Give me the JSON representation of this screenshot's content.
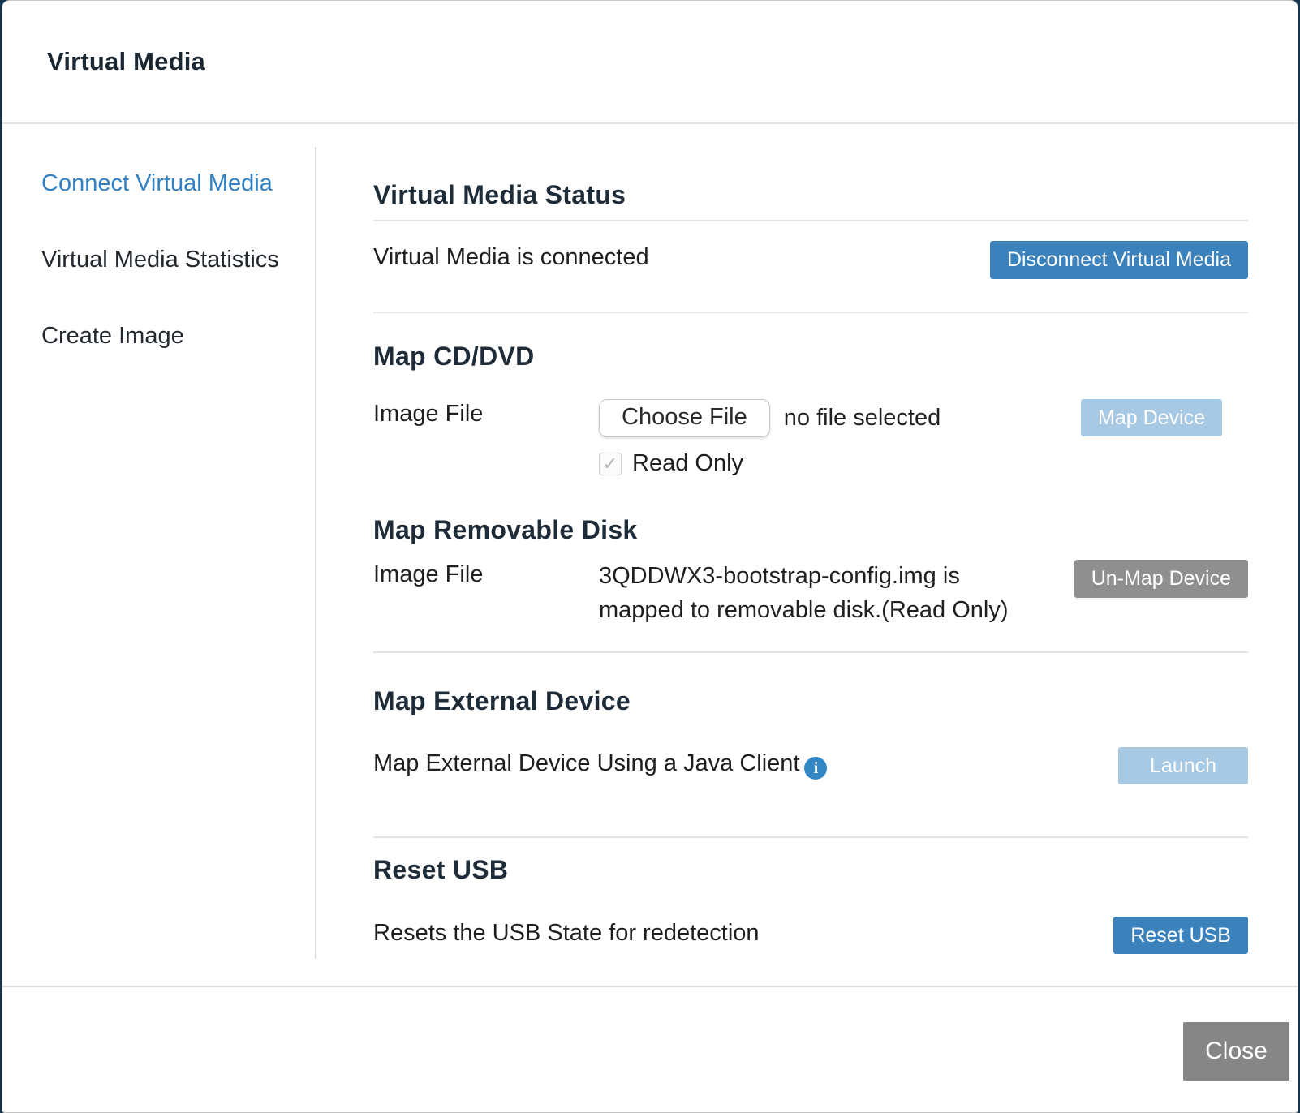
{
  "dialog": {
    "title": "Virtual Media",
    "close_label": "Close"
  },
  "sidebar": {
    "items": [
      {
        "label": "Connect Virtual Media",
        "active": true
      },
      {
        "label": "Virtual Media Statistics",
        "active": false
      },
      {
        "label": "Create Image",
        "active": false
      }
    ]
  },
  "sections": {
    "status": {
      "heading": "Virtual Media Status",
      "message": "Virtual Media is connected",
      "disconnect_button": "Disconnect Virtual Media"
    },
    "map_cd": {
      "heading": "Map CD/DVD",
      "image_file_label": "Image File",
      "choose_file_button": "Choose File",
      "no_file_text": "no file selected",
      "map_device_button": "Map Device",
      "map_device_enabled": false,
      "read_only_label": "Read Only",
      "read_only_checked": true
    },
    "map_removable": {
      "heading": "Map Removable Disk",
      "image_file_label": "Image File",
      "mapped_text_line1": "3QDDWX3-bootstrap-config.img is",
      "mapped_text_line2": "mapped to removable disk.(Read Only)",
      "unmap_button": "Un-Map Device"
    },
    "map_external": {
      "heading": "Map External Device",
      "text": "Map External Device Using a Java Client",
      "launch_button": "Launch",
      "launch_enabled": false
    },
    "reset_usb": {
      "heading": "Reset USB",
      "text": "Resets the USB State for redetection",
      "reset_button": "Reset USB"
    }
  },
  "glyphs": {
    "check": "✓",
    "info": "i"
  },
  "colors": {
    "primary_button": "#3b82bd",
    "disabled_button": "#a7c9e3",
    "gray_button": "#8f8f8f",
    "close_button": "#868686",
    "active_link": "#3181c4",
    "heading_text": "#1d2c38",
    "body_text": "#1f1f1f",
    "divider": "#e2e2e2",
    "info_icon": "#3286c3",
    "backdrop": "#16334d"
  }
}
